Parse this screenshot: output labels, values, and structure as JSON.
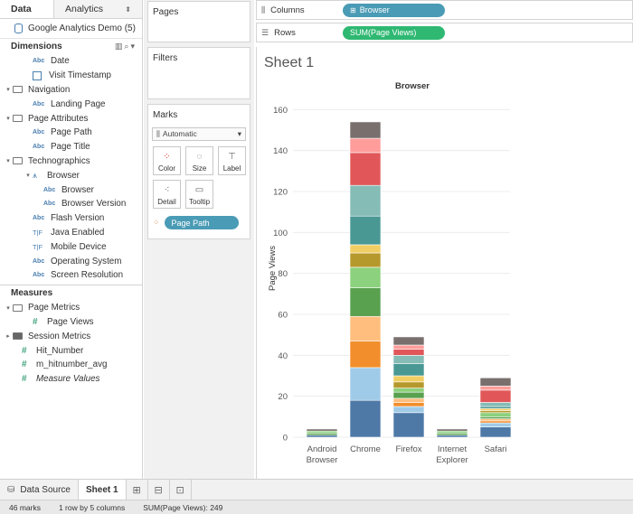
{
  "left_pane": {
    "tabs": [
      "Data",
      "Analytics"
    ],
    "datasource": "Google Analytics Demo (5)",
    "dimensions_label": "Dimensions",
    "dimensions": [
      {
        "label": "Date",
        "icon": "abc-icon",
        "indent": 1,
        "kind": "abc"
      },
      {
        "label": "Visit Timestamp",
        "icon": "calendar-icon",
        "indent": 1,
        "kind": "cal"
      },
      {
        "label": "Navigation",
        "icon": "folder-icon",
        "indent": 0,
        "kind": "folder"
      },
      {
        "label": "Landing Page",
        "icon": "abc-icon",
        "indent": 1,
        "kind": "abc"
      },
      {
        "label": "Page Attributes",
        "icon": "folder-icon",
        "indent": 0,
        "kind": "folder"
      },
      {
        "label": "Page Path",
        "icon": "abc-icon",
        "indent": 1,
        "kind": "abc"
      },
      {
        "label": "Page Title",
        "icon": "abc-icon",
        "indent": 1,
        "kind": "abc"
      },
      {
        "label": "Technographics",
        "icon": "folder-icon",
        "indent": 0,
        "kind": "folder"
      },
      {
        "label": "Browser",
        "icon": "hierarchy-icon",
        "indent": 1,
        "kind": "hier"
      },
      {
        "label": "Browser",
        "icon": "abc-icon",
        "indent": 2,
        "kind": "abc"
      },
      {
        "label": "Browser Version",
        "icon": "abc-icon",
        "indent": 2,
        "kind": "abc"
      },
      {
        "label": "Flash Version",
        "icon": "abc-icon",
        "indent": 1,
        "kind": "abc"
      },
      {
        "label": "Java Enabled",
        "icon": "boolean-icon",
        "indent": 1,
        "kind": "tf"
      },
      {
        "label": "Mobile Device",
        "icon": "boolean-icon",
        "indent": 1,
        "kind": "tf"
      },
      {
        "label": "Operating System",
        "icon": "abc-icon",
        "indent": 1,
        "kind": "abc"
      },
      {
        "label": "Screen Resolution",
        "icon": "abc-icon",
        "indent": 1,
        "kind": "abc"
      }
    ],
    "measures_label": "Measures",
    "measures": [
      {
        "label": "Page Metrics",
        "icon": "folder-icon",
        "indent": 0,
        "kind": "folder"
      },
      {
        "label": "Page Views",
        "icon": "number-icon",
        "indent": 1,
        "kind": "hash"
      },
      {
        "label": "Session Metrics",
        "icon": "folder-icon",
        "indent": 0,
        "kind": "folder-closed"
      },
      {
        "label": "Hit_Number",
        "icon": "number-icon",
        "indent": 0,
        "kind": "hash"
      },
      {
        "label": "m_hitnumber_avg",
        "icon": "number-icon",
        "indent": 0,
        "kind": "hash"
      },
      {
        "label": "Measure Values",
        "icon": "number-icon",
        "indent": 0,
        "kind": "hash",
        "italic": true
      }
    ]
  },
  "shelves": {
    "pages": "Pages",
    "filters": "Filters",
    "marks": "Marks",
    "mark_type": "Automatic",
    "mark_buttons": [
      {
        "label": "Color",
        "icon": "color-icon"
      },
      {
        "label": "Size",
        "icon": "size-icon"
      },
      {
        "label": "Label",
        "icon": "label-icon"
      },
      {
        "label": "Detail",
        "icon": "detail-icon"
      },
      {
        "label": "Tooltip",
        "icon": "tooltip-icon"
      }
    ],
    "mark_pill": "Page Path",
    "columns_label": "Columns",
    "columns_pill": "Browser",
    "rows_label": "Rows",
    "rows_pill": "SUM(Page Views)"
  },
  "sheet_title": "Sheet 1",
  "chart_data": {
    "type": "bar",
    "stacked": true,
    "title": "Browser",
    "xlabel": "",
    "ylabel": "Page Views",
    "ylim": [
      0,
      165
    ],
    "yticks": [
      0,
      20,
      40,
      60,
      80,
      100,
      120,
      140,
      160
    ],
    "grid": true,
    "categories": [
      "Android Browser",
      "Chrome",
      "Firefox",
      "Internet Explorer",
      "Safari"
    ],
    "category_lines": [
      [
        "Android",
        "Browser"
      ],
      [
        "Chrome"
      ],
      [
        "Firefox"
      ],
      [
        "Internet",
        "Explorer"
      ],
      [
        "Safari"
      ]
    ],
    "palette": [
      "#4e79a7",
      "#a0cbe8",
      "#f28e2b",
      "#ffbe7d",
      "#59a14f",
      "#8cd17d",
      "#b6992d",
      "#f1ce63",
      "#499894",
      "#86bcb6",
      "#e15759",
      "#ff9d9a",
      "#79706e"
    ],
    "stacks": [
      [
        1,
        1,
        1,
        1
      ],
      [
        18,
        16,
        13,
        12,
        14,
        10,
        7,
        4,
        14,
        15,
        16,
        7,
        8
      ],
      [
        12,
        3,
        2,
        2,
        3,
        2,
        3,
        3,
        6,
        4,
        3,
        2,
        4
      ],
      [
        1,
        1,
        1,
        1
      ],
      [
        5,
        2,
        1,
        1,
        1,
        2,
        1,
        1,
        1,
        2,
        6,
        2,
        4
      ]
    ],
    "stack_colors": [
      [
        "#4e79a7",
        "#59a14f",
        "#8cd17d",
        "#79706e"
      ],
      null,
      null,
      [
        "#4e79a7",
        "#59a14f",
        "#8cd17d",
        "#79706e"
      ],
      null
    ]
  },
  "bottom_tabs": {
    "data_source": "Data Source",
    "sheet": "Sheet 1",
    "new_icons": [
      "new-worksheet-icon",
      "new-dashboard-icon",
      "new-story-icon"
    ]
  },
  "status": {
    "marks": "46 marks",
    "layout": "1 row by 5 columns",
    "sum": "SUM(Page Views): 249"
  }
}
